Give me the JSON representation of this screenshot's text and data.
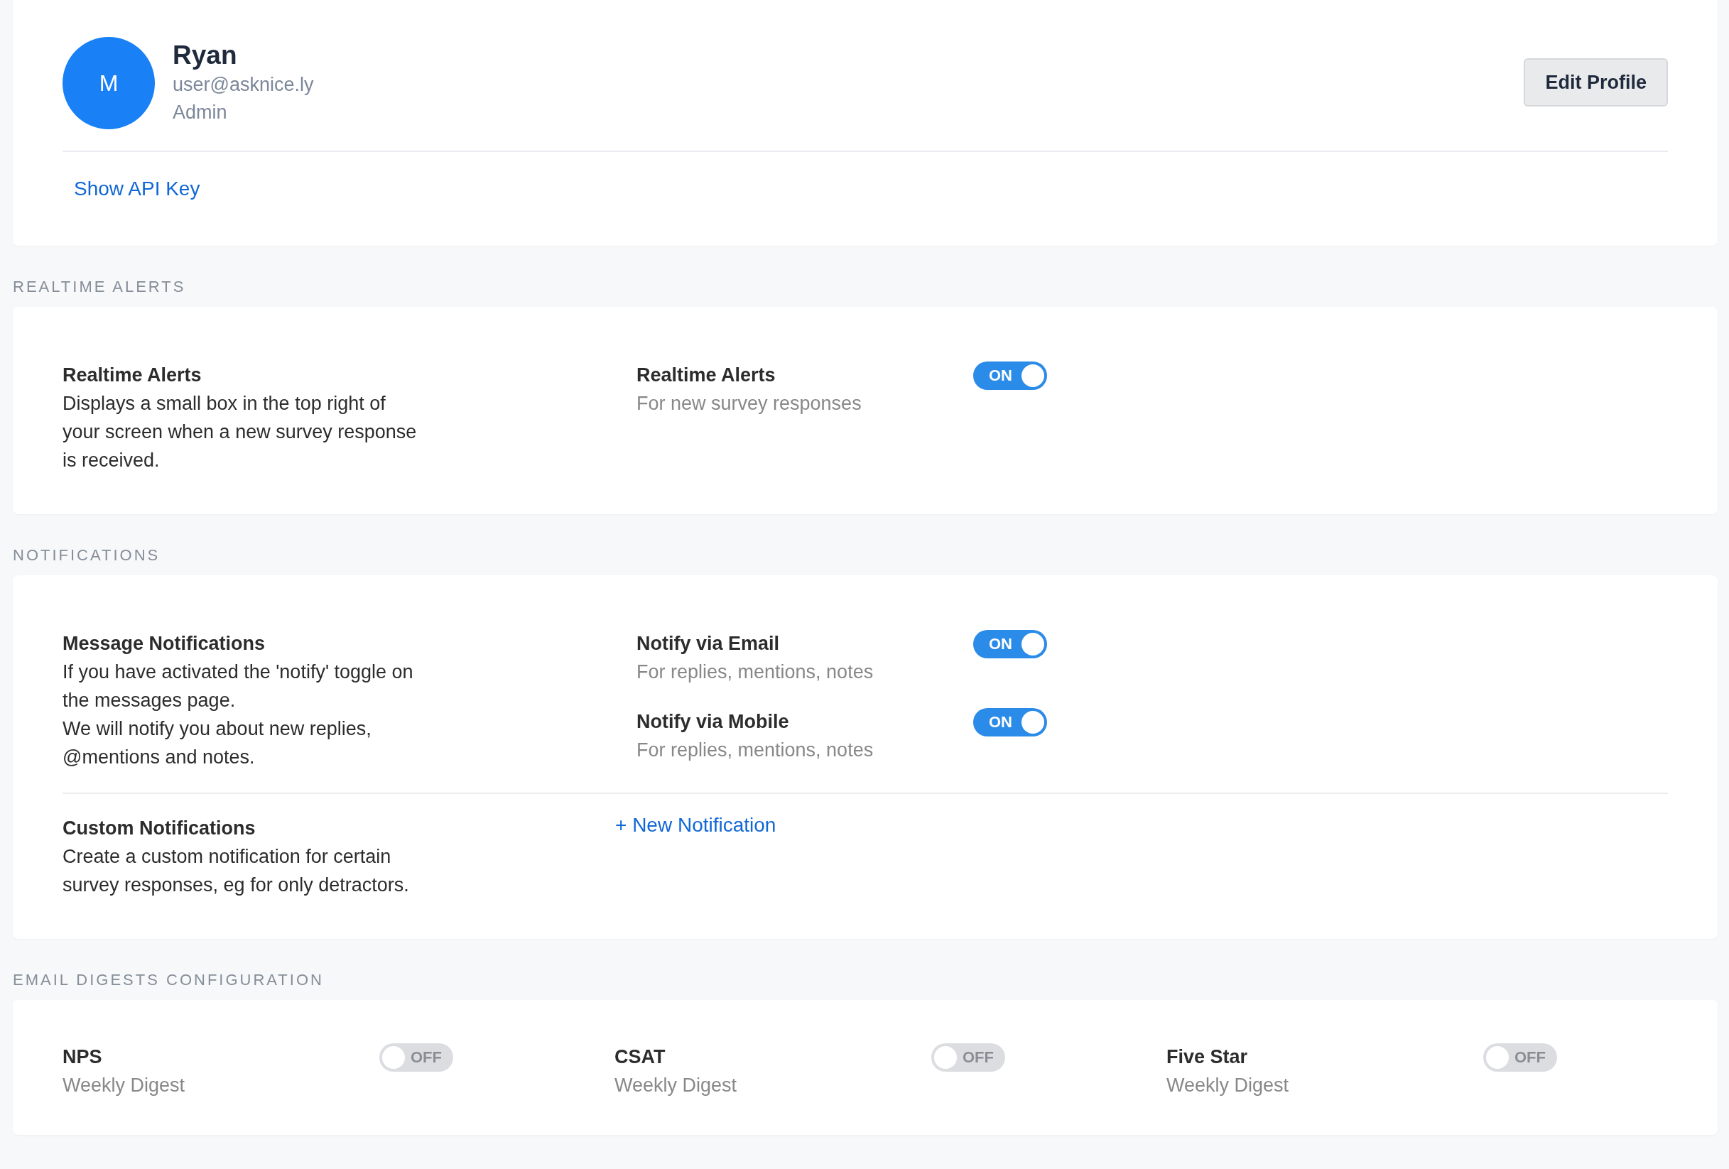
{
  "profile": {
    "avatar_initial": "M",
    "name": "Ryan",
    "email": "user@asknice.ly",
    "role": "Admin",
    "edit_button": "Edit Profile",
    "api_link": "Show API Key"
  },
  "realtime_alerts": {
    "heading": "REALTIME ALERTS",
    "title": "Realtime Alerts",
    "description": [
      "Displays a small box in the top right of your screen when a new survey response is received."
    ],
    "settings": [
      {
        "label": "Realtime Alerts",
        "sublabel": "For new survey responses",
        "on": true,
        "toggle_text": "ON"
      }
    ]
  },
  "notifications": {
    "heading": "NOTIFICATIONS",
    "message": {
      "title": "Message Notifications",
      "description": [
        "If you have activated the 'notify' toggle on the messages page.",
        "We will notify you about new replies, @mentions and notes."
      ],
      "settings": [
        {
          "label": "Notify via Email",
          "sublabel": "For replies, mentions, notes",
          "on": true,
          "toggle_text": "ON"
        },
        {
          "label": "Notify via Mobile",
          "sublabel": "For replies, mentions, notes",
          "on": true,
          "toggle_text": "ON"
        }
      ]
    },
    "custom": {
      "title": "Custom Notifications",
      "description": [
        "Create a custom notification for certain survey responses, eg for only detractors."
      ],
      "link": "+ New Notification"
    }
  },
  "email_digests": {
    "heading": "EMAIL DIGESTS CONFIGURATION",
    "items": [
      {
        "name": "NPS",
        "sublabel": "Weekly Digest",
        "on": false,
        "toggle_text": "OFF"
      },
      {
        "name": "CSAT",
        "sublabel": "Weekly Digest",
        "on": false,
        "toggle_text": "OFF"
      },
      {
        "name": "Five Star",
        "sublabel": "Weekly Digest",
        "on": false,
        "toggle_text": "OFF"
      }
    ]
  }
}
